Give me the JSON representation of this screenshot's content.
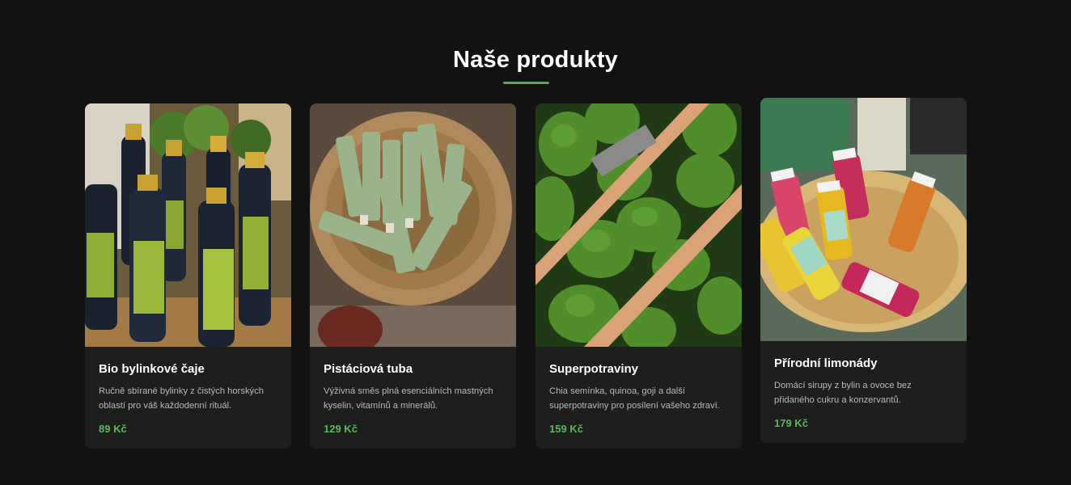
{
  "section": {
    "title": "Naše produkty"
  },
  "colors": {
    "background": "#121212",
    "card": "#1e1e1e",
    "accent": "#4caf50",
    "price": "#56b85a"
  },
  "products": [
    {
      "name": "Bio bylinkové čaje",
      "description": "Ručně sbírané bylinky z čistých horských oblastí pro váš každodenní rituál.",
      "price": "89 Kč",
      "image_icon": "syrup-bottles-image"
    },
    {
      "name": "Pistáciová tuba",
      "description": "Výživná směs plná esenciálních mastných kyselin, vitamínů a minerálů.",
      "price": "129 Kč",
      "image_icon": "green-tubes-basket-image"
    },
    {
      "name": "Superpotraviny",
      "description": "Chia semínka, quinoa, goji a další superpotraviny pro posílení vašeho zdraví.",
      "price": "159 Kč",
      "image_icon": "avocado-crate-image"
    },
    {
      "name": "Přírodní limonády",
      "description": "Domácí sirupy z bylin a ovoce bez přidaného cukru a konzervantů.",
      "price": "179 Kč",
      "image_icon": "lemonade-bottles-image"
    }
  ]
}
